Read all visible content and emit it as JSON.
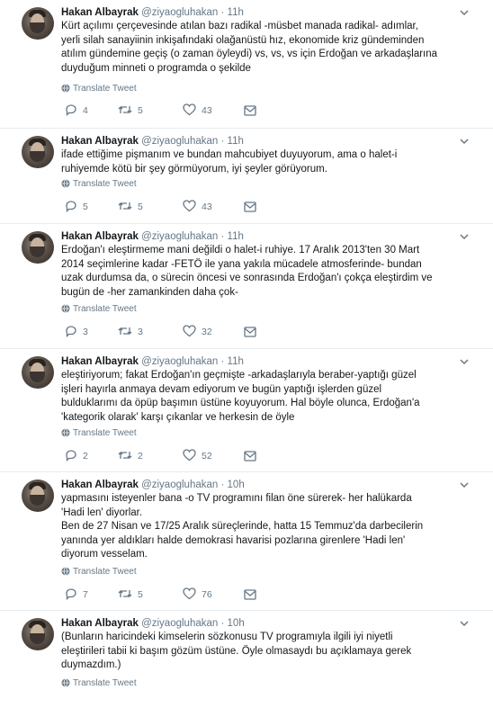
{
  "translate_label": "Translate Tweet",
  "tweets": [
    {
      "name": "Hakan Albayrak",
      "handle": "@ziyaogluhakan",
      "dot": "·",
      "time": "11h",
      "text": "Kürt açılımı çerçevesinde atılan bazı radikal -müsbet manada radikal- adımlar,\nyerli silah sanayiinin inkişafındaki olağanüstü hız, ekonomide kriz gündeminden\natılım gündemine geçiş (o zaman öyleydi) vs, vs, vs için Erdoğan ve arkadaşlarına\nduyduğum minneti o programda o şekilde",
      "replies": "4",
      "retweets": "5",
      "likes": "43"
    },
    {
      "name": "Hakan Albayrak",
      "handle": "@ziyaogluhakan",
      "dot": "·",
      "time": "11h",
      "text": "ifade ettiğime pişmanım ve bundan mahcubiyet duyuyorum, ama o halet-i\nruhiyemde kötü bir şey görmüyorum, iyi şeyler görüyorum.",
      "replies": "5",
      "retweets": "5",
      "likes": "43"
    },
    {
      "name": "Hakan Albayrak",
      "handle": "@ziyaogluhakan",
      "dot": "·",
      "time": "11h",
      "text": "Erdoğan'ı eleştirmeme mani değildi o halet-i ruhiye. 17 Aralık  2013'ten 30 Mart\n2014 seçimlerine kadar -FETÖ ile yana yakıla mücadele atmosferinde- bundan\nuzak durdumsa da, o sürecin öncesi ve sonrasında Erdoğan'ı çokça eleştirdim ve\nbugün de -her zamankinden daha çok-",
      "replies": "3",
      "retweets": "3",
      "likes": "32"
    },
    {
      "name": "Hakan Albayrak",
      "handle": "@ziyaogluhakan",
      "dot": "·",
      "time": "11h",
      "text": "eleştiriyorum; fakat Erdoğan'ın geçmişte -arkadaşlarıyla beraber-yaptığı güzel\nişleri hayırla anmaya devam ediyorum ve bugün yaptığı işlerden güzel\nbulduklarımı da öpüp başımın üstüne koyuyorum. Hal böyle olunca, Erdoğan'a\n'kategorik olarak' karşı çıkanlar ve herkesin de öyle",
      "replies": "2",
      "retweets": "2",
      "likes": "52"
    },
    {
      "name": "Hakan Albayrak",
      "handle": "@ziyaogluhakan",
      "dot": "·",
      "time": "10h",
      "text": "yapmasını isteyenler bana -o TV programını filan öne sürerek- her halükarda\n'Hadi len' diyorlar.\nBen de 27 Nisan ve 17/25 Aralık süreçlerinde, hatta 15 Temmuz'da darbecilerin\nyanında yer aldıkları halde demokrasi havarisi pozlarına girenlere 'Hadi len'\ndiyorum vesselam.",
      "replies": "7",
      "retweets": "5",
      "likes": "76"
    },
    {
      "name": "Hakan Albayrak",
      "handle": "@ziyaogluhakan",
      "dot": "·",
      "time": "10h",
      "text": "(Bunların haricindeki kimselerin sözkonusu TV programıyla ilgili iyi niyetli\neleştirileri tabii ki başım gözüm üstüne. Öyle olmasaydı bu açıklamaya gerek\nduymazdım.)"
    }
  ]
}
